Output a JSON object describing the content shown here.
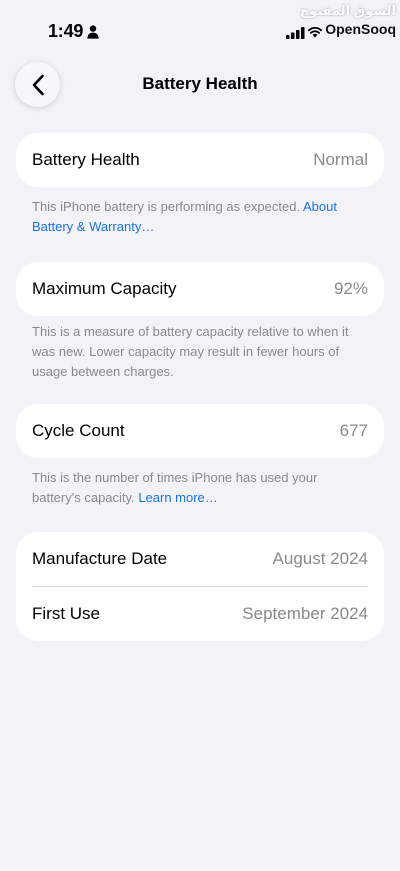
{
  "status_bar": {
    "time": "1:49",
    "watermark_arabic": "السوق المفتوح",
    "watermark_latin": "OpenSooq"
  },
  "icons": {
    "person": "person-icon",
    "signal": "cellular-signal-icon",
    "wifi": "wifi-icon",
    "back": "chevron-left-icon"
  },
  "nav": {
    "title": "Battery Health"
  },
  "battery_health": {
    "label": "Battery Health",
    "value": "Normal",
    "note": "This iPhone battery is performing as expected.",
    "link": "About Battery & Warranty…"
  },
  "maximum_capacity": {
    "label": "Maximum Capacity",
    "value": "92%",
    "note": "This is a measure of battery capacity relative to when it was new. Lower capacity may result in fewer hours of usage between charges."
  },
  "cycle_count": {
    "label": "Cycle Count",
    "value": "677",
    "note": "This is the number of times iPhone has used your battery's capacity.",
    "link": "Learn more…"
  },
  "dates": {
    "manufacture_label": "Manufacture Date",
    "manufacture_value": "August 2024",
    "first_use_label": "First Use",
    "first_use_value": "September 2024"
  },
  "colors": {
    "background": "#f2f2f7",
    "card": "#ffffff",
    "secondary_text": "#8a8a8e",
    "link": "#1a73e8"
  }
}
